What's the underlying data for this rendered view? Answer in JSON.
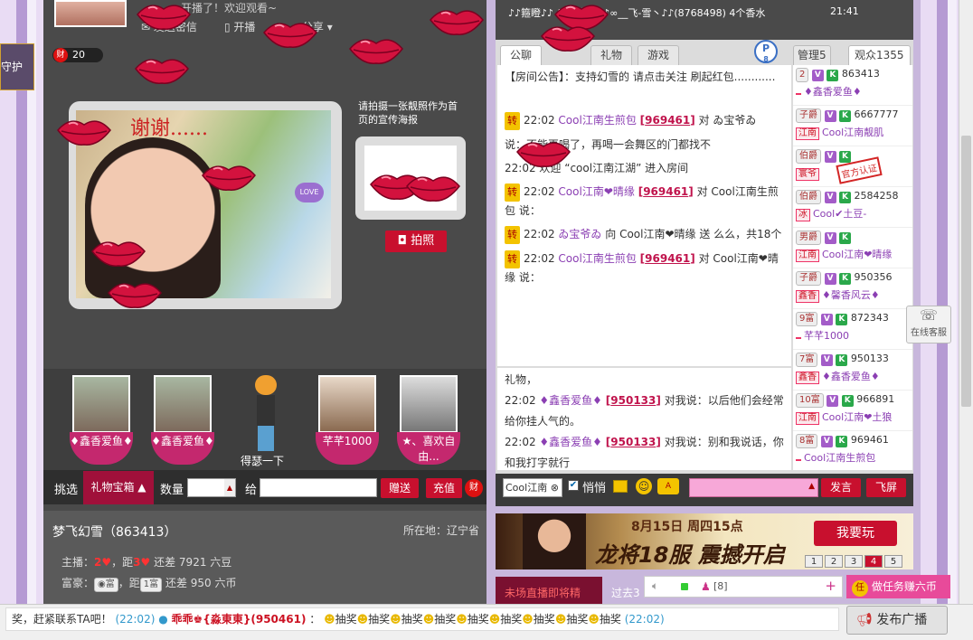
{
  "header": {
    "top_text": "开播了！欢迎观看~",
    "send_msg": "发送密信",
    "open_broadcast": "开播",
    "share": "分享",
    "side_tab": "守护",
    "cai_icon": "财",
    "cai_count": "20",
    "top_notice": "♪♪箍瞪♪♪ (9) 送给 ♪♪∞__飞-雪丶♪♪(8768498) 4个香水",
    "top_time": "21:41"
  },
  "video": {
    "thanks_text": "谢谢......",
    "love_badge": "LOVE"
  },
  "poster": {
    "hint": "请拍摄一张靓照作为首页的宣传海报",
    "photo_button": "拍照"
  },
  "guests": [
    {
      "label": "♦鑫香爱鱼♦"
    },
    {
      "label": "♦鑫香爱鱼♦"
    },
    {
      "label": "得瑟一下"
    },
    {
      "label": "芊芊1000"
    },
    {
      "label": "★、喜欢自由..."
    }
  ],
  "gift_bar": {
    "pick": "挑选",
    "gift_box": "礼物宝箱",
    "qty_label": "数量",
    "to_label": "给",
    "give_btn": "赠送",
    "recharge_btn": "充值",
    "cai_small": "财"
  },
  "room": {
    "name": "梦飞幻雪（863413）",
    "location": "所在地：辽宁省",
    "host_label": "主播：",
    "host_level": "2",
    "host_dist": "，距",
    "host_next": "3",
    "host_remain": "还差 7921 六豆",
    "rich_label": "富豪：",
    "rich_dist": "，距",
    "rich_next": "1富",
    "rich_remain": "还差 950 六币"
  },
  "chat_tabs": {
    "public": "公聊",
    "private": "",
    "gift": "礼物",
    "game": "游戏",
    "p_badge": "P",
    "p_num": "8"
  },
  "announcement": "【房间公告】：支持幻雪的 请点击关注 刷起红包............",
  "chat_messages": [
    {
      "time": "22:02",
      "from": "Cool江南生煎包",
      "id": "969461",
      "text": " 对 ゐ宝爷ゐ"
    },
    {
      "time": "",
      "from": "",
      "id": "",
      "text": "说：不能再喝了，再喝一会舞区的门都找不"
    },
    {
      "time": "22:02",
      "from": "",
      "id": "",
      "text": "欢迎 “cool江南江湖” 进入房间"
    },
    {
      "time": "22:02",
      "from": "Cool江南❤晴缘",
      "id": "969461",
      "text": "对 Cool江南生煎包 说："
    },
    {
      "time": "22:02",
      "from": "ゐ宝爷ゐ",
      "id": "",
      "text": "向 Cool江南❤晴缘 送  么么，共18个"
    },
    {
      "time": "22:02",
      "from": "Cool江南生煎包",
      "id": "969461",
      "text": "对 Cool江南❤晴缘 说："
    }
  ],
  "private_chat": {
    "header": "礼物，",
    "messages": [
      {
        "time": "22:02",
        "from": "♦鑫香爱鱼♦",
        "id": "950133",
        "text": "对我说：以后他们会经常给你挂人气的。"
      },
      {
        "time": "22:02",
        "from": "♦鑫香爱鱼♦",
        "id": "950133",
        "text": "对我说：别和我说话，你和我打字就行"
      }
    ]
  },
  "input_bar": {
    "target": "Cool江南",
    "whisper": "悄悄",
    "send": "发言",
    "fly": "飞屏"
  },
  "user_list": {
    "tab_admin": "管理5",
    "tab_audience": "观众1355",
    "rows": [
      {
        "badge": "2",
        "name": "863413",
        "sub": "♦鑫香爱鱼♦",
        "tag": ""
      },
      {
        "badge": "子爵",
        "name": "6667777",
        "sub": "Cool江南靓肌",
        "tag": "江南"
      },
      {
        "badge": "伯爵",
        "name": "",
        "sub": "",
        "tag": "寰爷"
      },
      {
        "badge": "伯爵",
        "name": "2584258",
        "sub": "Cool✔土豆-",
        "tag": "冰"
      },
      {
        "badge": "男爵",
        "name": "",
        "sub": "Cool江南❤晴缘",
        "tag": "江南"
      },
      {
        "badge": "子爵",
        "name": "950356",
        "sub": "♦馨香风云♦",
        "tag": "鑫香"
      },
      {
        "badge": "9富",
        "name": "872343",
        "sub": "芊芊1000",
        "tag": ""
      },
      {
        "badge": "7富",
        "name": "950133",
        "sub": "♦鑫香爱鱼♦",
        "tag": "鑫香"
      },
      {
        "badge": "10富",
        "name": "966891",
        "sub": "Cool江南❤土狼",
        "tag": "江南"
      },
      {
        "badge": "8富",
        "name": "969461",
        "sub": "Cool江南生煎包",
        "tag": ""
      }
    ],
    "stamp": "官方认证"
  },
  "service": {
    "label": "在线客服"
  },
  "ad": {
    "date": "8月15日 周四15点",
    "title": "龙将18服 震撼开启",
    "play": "我要玩",
    "pages": [
      "1",
      "2",
      "3",
      "4",
      "5"
    ],
    "current_page": "4"
  },
  "bottom_row": {
    "left_text": "未场直播即将精",
    "mid_text": "过去3",
    "user_count": "[8]",
    "task": "做任务赚六币",
    "task_icon": "任"
  },
  "footer": {
    "marquee_start": "奖，赶紧联系TA吧！",
    "time1": "(22:02)",
    "user": "乖乖♚{淼東東}(950461)",
    "reward": "抽奖",
    "time2": "(22:02)",
    "broadcast": "发布广播"
  },
  "colors": {
    "panel_dark": "#4a4a4a",
    "accent_red": "#c8102e",
    "accent_pink": "#e84a9a",
    "name_purple": "#8b3fb3"
  }
}
